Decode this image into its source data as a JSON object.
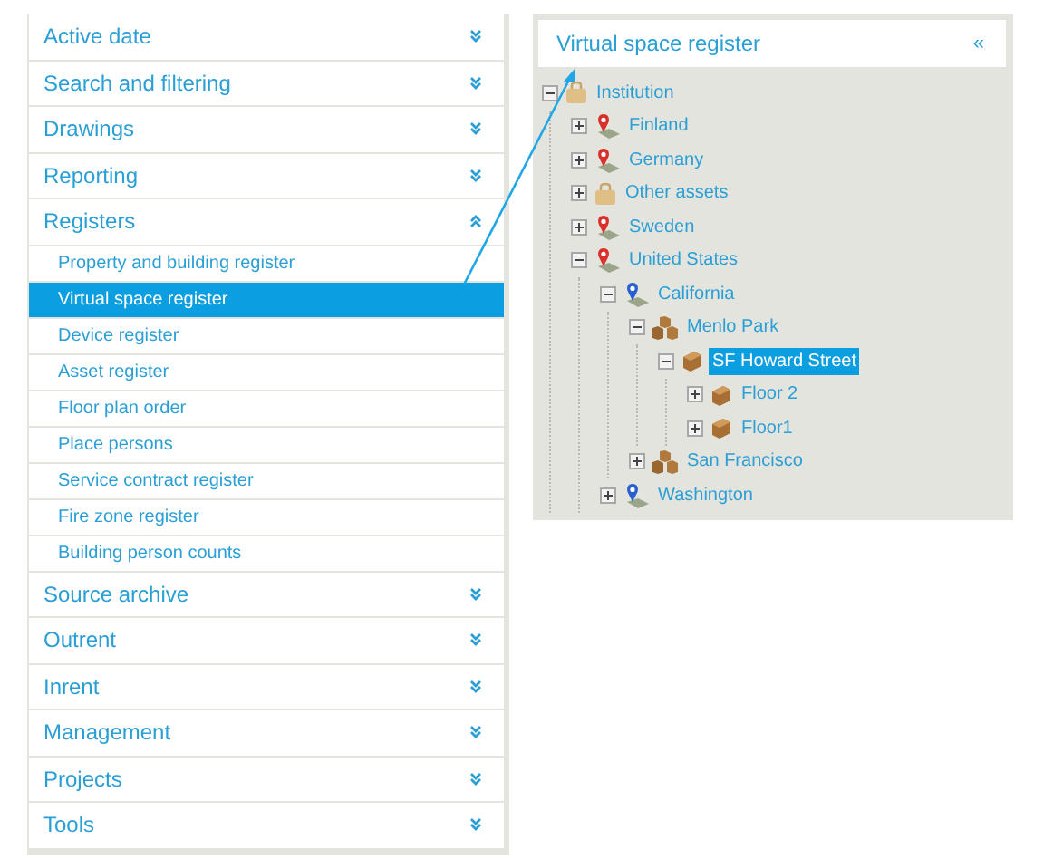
{
  "menu": {
    "sections": [
      {
        "label": "Active date",
        "expanded": false
      },
      {
        "label": "Search and filtering",
        "expanded": false
      },
      {
        "label": "Drawings",
        "expanded": false
      },
      {
        "label": "Reporting",
        "expanded": false
      },
      {
        "label": "Registers",
        "expanded": true,
        "items": [
          {
            "label": "Property and building register",
            "selected": false
          },
          {
            "label": "Virtual space register",
            "selected": true
          },
          {
            "label": "Device register",
            "selected": false
          },
          {
            "label": "Asset register",
            "selected": false
          },
          {
            "label": "Floor plan order",
            "selected": false
          },
          {
            "label": "Place persons",
            "selected": false
          },
          {
            "label": "Service contract register",
            "selected": false
          },
          {
            "label": "Fire zone register",
            "selected": false
          },
          {
            "label": "Building person counts",
            "selected": false
          }
        ]
      },
      {
        "label": "Source archive",
        "expanded": false
      },
      {
        "label": "Outrent",
        "expanded": false
      },
      {
        "label": "Inrent",
        "expanded": false
      },
      {
        "label": "Management",
        "expanded": false
      },
      {
        "label": "Projects",
        "expanded": false
      },
      {
        "label": "Tools",
        "expanded": false
      }
    ]
  },
  "panel": {
    "title": "Virtual space register",
    "collapse_icon": "«",
    "tree": [
      {
        "label": "Institution",
        "kind": "folder",
        "expanded": true,
        "selected": false,
        "children": [
          {
            "label": "Finland",
            "kind": "country",
            "expanded": false,
            "selected": false
          },
          {
            "label": "Germany",
            "kind": "country",
            "expanded": false,
            "selected": false
          },
          {
            "label": "Other assets",
            "kind": "folder",
            "expanded": false,
            "selected": false
          },
          {
            "label": "Sweden",
            "kind": "country",
            "expanded": false,
            "selected": false
          },
          {
            "label": "United States",
            "kind": "country",
            "expanded": true,
            "selected": false,
            "children": [
              {
                "label": "California",
                "kind": "region",
                "expanded": true,
                "selected": false,
                "children": [
                  {
                    "label": "Menlo Park",
                    "kind": "site",
                    "expanded": true,
                    "selected": false,
                    "children": [
                      {
                        "label": "SF Howard Street",
                        "kind": "building",
                        "expanded": true,
                        "selected": true,
                        "children": [
                          {
                            "label": "Floor 2",
                            "kind": "floor",
                            "expanded": false,
                            "selected": false
                          },
                          {
                            "label": "Floor1",
                            "kind": "floor",
                            "expanded": false,
                            "selected": false
                          }
                        ]
                      }
                    ]
                  },
                  {
                    "label": "San Francisco",
                    "kind": "site",
                    "expanded": false,
                    "selected": false
                  }
                ]
              },
              {
                "label": "Washington",
                "kind": "region",
                "expanded": false,
                "selected": false
              }
            ]
          }
        ]
      }
    ]
  }
}
